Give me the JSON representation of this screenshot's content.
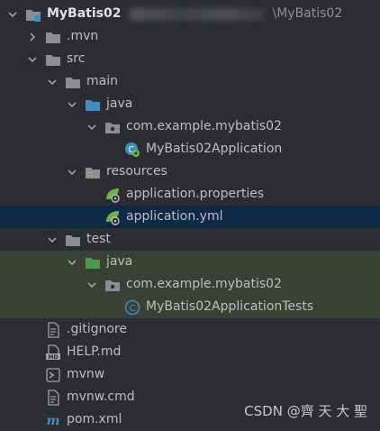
{
  "project": {
    "name": "MyBatis02",
    "path_tail": "\\MyBatis02"
  },
  "tree": [
    {
      "label": ".mvn",
      "indent": 1,
      "chevron": "right",
      "icon": "folder-icon"
    },
    {
      "label": "src",
      "indent": 1,
      "chevron": "down",
      "icon": "folder-icon"
    },
    {
      "label": "main",
      "indent": 2,
      "chevron": "down",
      "icon": "folder-icon"
    },
    {
      "label": "java",
      "indent": 3,
      "chevron": "down",
      "icon": "source-folder-icon"
    },
    {
      "label": "com.example.mybatis02",
      "indent": 4,
      "chevron": "down",
      "icon": "package-icon"
    },
    {
      "label": "MyBatis02Application",
      "indent": 5,
      "chevron": "",
      "icon": "spring-boot-class-icon"
    },
    {
      "label": "resources",
      "indent": 3,
      "chevron": "down",
      "icon": "resources-folder-icon"
    },
    {
      "label": "application.properties",
      "indent": 4,
      "chevron": "",
      "icon": "spring-config-icon"
    },
    {
      "label": "application.yml",
      "indent": 4,
      "chevron": "",
      "icon": "spring-config-icon",
      "state": "selected"
    },
    {
      "label": "test",
      "indent": 2,
      "chevron": "down",
      "icon": "folder-icon"
    },
    {
      "label": "java",
      "indent": 3,
      "chevron": "down",
      "icon": "test-folder-icon",
      "state": "hl"
    },
    {
      "label": "com.example.mybatis02",
      "indent": 4,
      "chevron": "down",
      "icon": "package-icon",
      "state": "hl"
    },
    {
      "label": "MyBatis02ApplicationTests",
      "indent": 5,
      "chevron": "",
      "icon": "test-class-icon",
      "state": "hl"
    },
    {
      "label": ".gitignore",
      "indent": 1,
      "chevron": "",
      "icon": "text-file-icon"
    },
    {
      "label": "HELP.md",
      "indent": 1,
      "chevron": "",
      "icon": "markdown-file-icon"
    },
    {
      "label": "mvnw",
      "indent": 1,
      "chevron": "",
      "icon": "terminal-file-icon"
    },
    {
      "label": "mvnw.cmd",
      "indent": 1,
      "chevron": "",
      "icon": "text-file-icon"
    },
    {
      "label": "pom.xml",
      "indent": 1,
      "chevron": "",
      "icon": "maven-icon"
    }
  ],
  "watermark": "CSDN @齊 天 大 聖",
  "colors": {
    "background": "#2b2d30",
    "selected": "#0f2a46",
    "test_highlight": "#3a4134",
    "folder": "#8b8e94",
    "source_folder": "#3d8fc4",
    "test_folder": "#4c9a4c",
    "spring": "#6db33f"
  }
}
